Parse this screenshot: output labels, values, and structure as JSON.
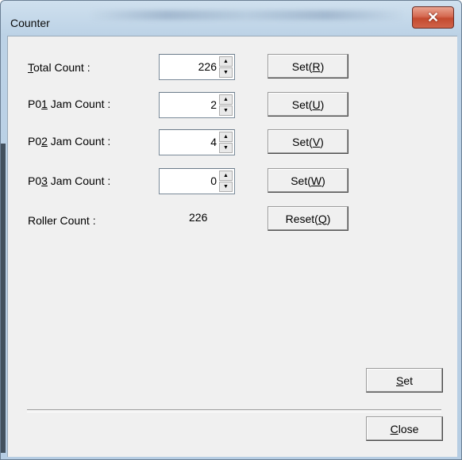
{
  "window": {
    "title": "Counter",
    "close_glyph": "✕"
  },
  "rows": [
    {
      "label_pre": "",
      "label_key": "T",
      "label_post": "otal Count :",
      "value": "226",
      "button_pre": "Set(",
      "button_key": "R",
      "button_post": ")"
    },
    {
      "label_pre": "P0",
      "label_key": "1",
      "label_post": " Jam Count :",
      "value": "2",
      "button_pre": "Set(",
      "button_key": "U",
      "button_post": ")"
    },
    {
      "label_pre": "P0",
      "label_key": "2",
      "label_post": " Jam Count :",
      "value": "4",
      "button_pre": "Set(",
      "button_key": "V",
      "button_post": ")"
    },
    {
      "label_pre": "P0",
      "label_key": "3",
      "label_post": " Jam Count :",
      "value": "0",
      "button_pre": "Set(",
      "button_key": "W",
      "button_post": ")"
    }
  ],
  "roller": {
    "label": "Roller Count :",
    "value": "226",
    "button_pre": "Reset(",
    "button_key": "Q",
    "button_post": ")"
  },
  "footer": {
    "set_key": "S",
    "set_rest": "et",
    "close_key": "C",
    "close_rest": "lose"
  },
  "icons": {
    "spin_up": "spin-up-icon",
    "spin_down": "spin-down-icon",
    "close": "close-icon"
  },
  "colors": {
    "close_button": "#c44a2f",
    "dialog_bg": "#f0f0f0",
    "frame": "#b6cde3"
  }
}
